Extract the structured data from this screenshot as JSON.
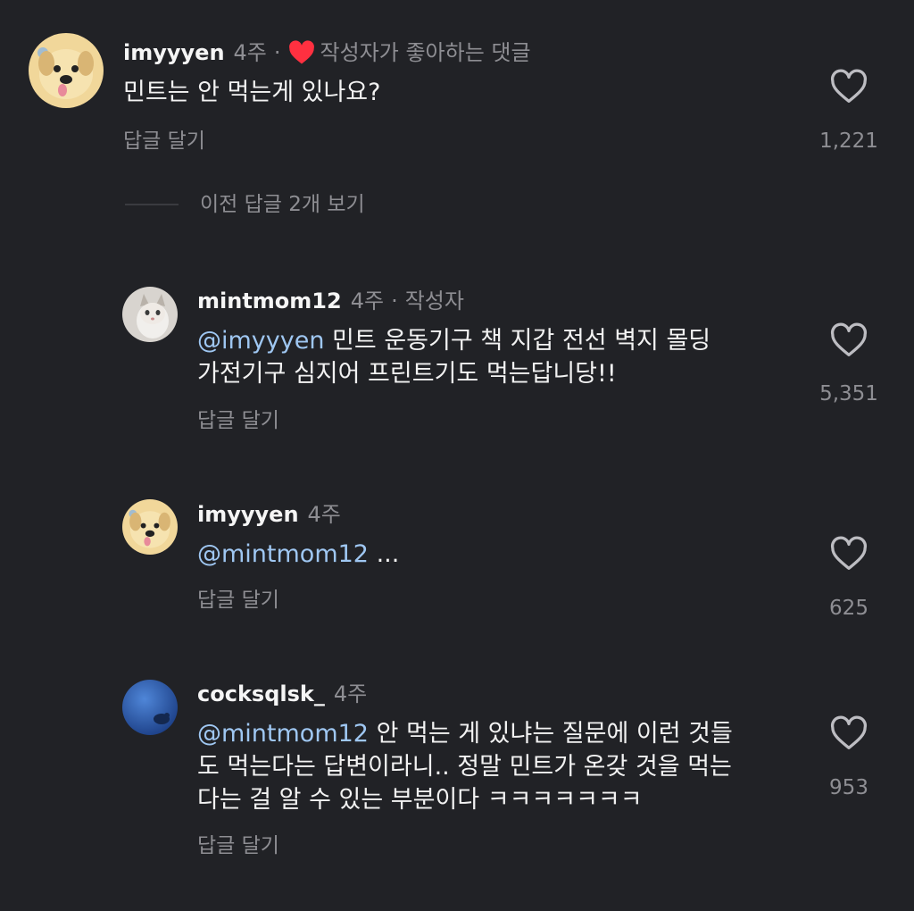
{
  "comments": [
    {
      "username": "imyyyen",
      "time": "4주",
      "sep": "·",
      "liked_text": "작성자가 좋아하는 댓글",
      "text": "민트는 안 먹는게 있나요?",
      "reply_label": "답글 달기",
      "likes": "1,221"
    },
    {
      "username": "mintmom12",
      "time": "4주",
      "sep": "·",
      "author_tag": "작성자",
      "mention": "@imyyyen",
      "text_line1": " 민트 운동기구 책 지갑 전선 벽지 몰딩",
      "text_line2": "가전기구 심지어 프린트기도 먹는답니당!!",
      "reply_label": "답글 달기",
      "likes": "5,351"
    },
    {
      "username": "imyyyen",
      "time": "4주",
      "mention": "@mintmom12",
      "text": " ...",
      "reply_label": "답글 달기",
      "likes": "625"
    },
    {
      "username": "cocksqlsk_",
      "time": "4주",
      "mention": "@mintmom12",
      "text_line1": " 안 먹는 게 있냐는 질문에 이런 것들",
      "text_line2": "도 먹는다는 답변이라니.. 정말 민트가 온갖 것을 먹는",
      "text_line3": "다는 걸 알 수 있는 부분이다 ㅋㅋㅋㅋㅋㅋㅋ",
      "reply_label": "답글 달기",
      "likes": "953"
    }
  ],
  "view_previous": "이전 답글 2개 보기",
  "icons": {
    "like": "heart-outline-icon",
    "liked_by_author": "heart-filled-icon"
  },
  "colors": {
    "background": "#212226",
    "mention": "#9fc7f2",
    "muted": "#8e8e93",
    "liked_heart": "#ff3040"
  }
}
